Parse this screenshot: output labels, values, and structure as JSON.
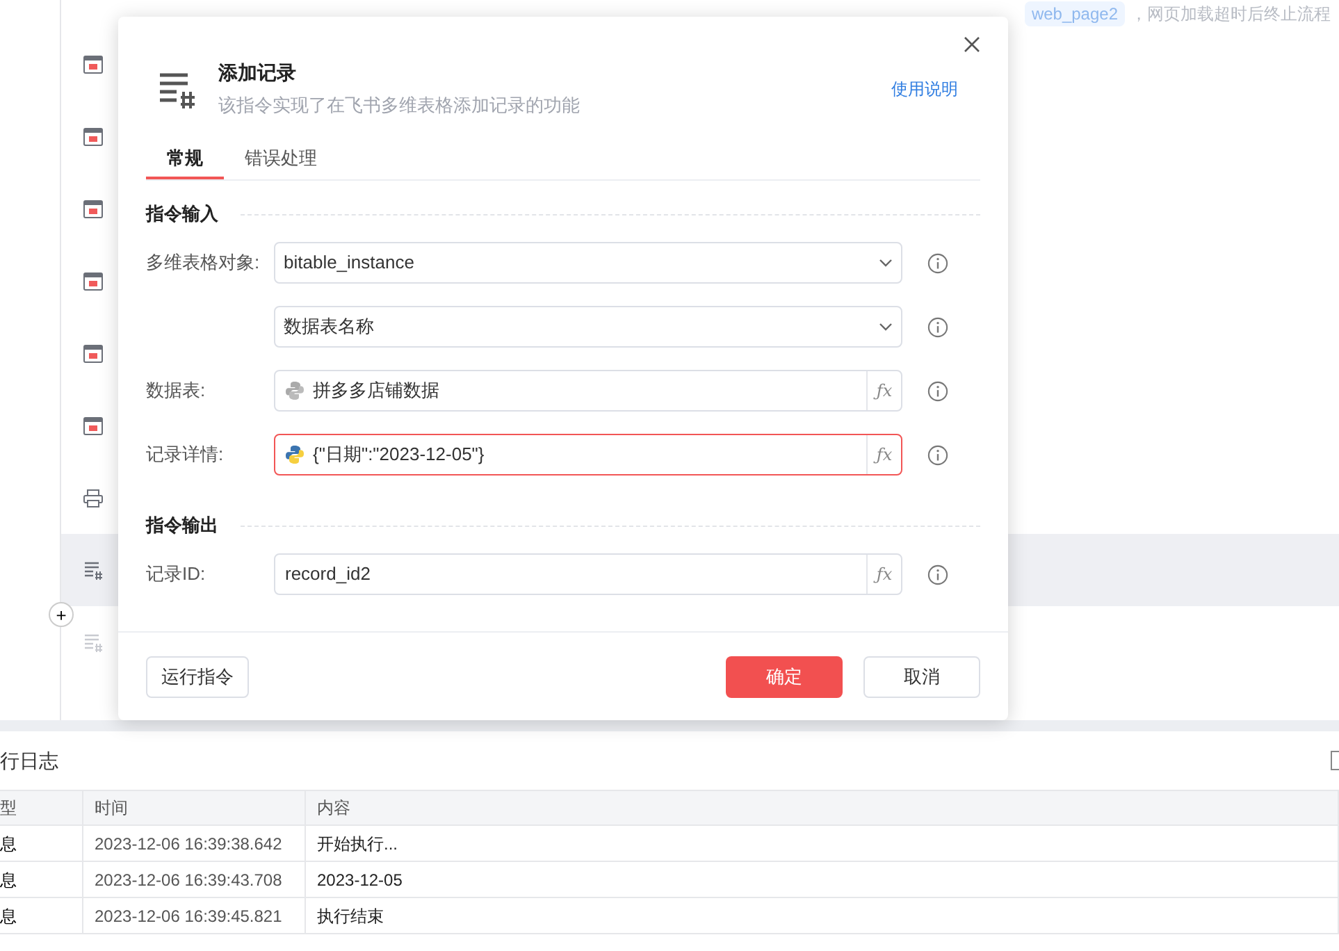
{
  "background_step": {
    "variable": "web_page2",
    "text_after": "，网页加载超时后终止流程"
  },
  "steps": [
    {
      "kind": "window",
      "selected": false,
      "disabled": false
    },
    {
      "kind": "window",
      "selected": false,
      "disabled": false
    },
    {
      "kind": "window",
      "selected": false,
      "disabled": false
    },
    {
      "kind": "window",
      "selected": false,
      "disabled": false
    },
    {
      "kind": "window",
      "selected": false,
      "disabled": false
    },
    {
      "kind": "window",
      "selected": false,
      "disabled": false
    },
    {
      "kind": "printer",
      "selected": false,
      "disabled": false
    },
    {
      "kind": "table",
      "selected": true,
      "disabled": false
    },
    {
      "kind": "table",
      "selected": false,
      "disabled": true
    }
  ],
  "add_button": "+",
  "dialog": {
    "title": "添加记录",
    "description": "该指令实现了在飞书多维表格添加记录的功能",
    "help_link": "使用说明",
    "tabs": [
      {
        "label": "常规",
        "selected": true
      },
      {
        "label": "错误处理",
        "selected": false
      }
    ],
    "sections": [
      {
        "title": "指令输入",
        "fields": [
          {
            "label": "多维表格对象:",
            "kind": "select",
            "value": "bitable_instance",
            "error": false
          },
          {
            "kind": "select",
            "value": "数据表名称",
            "error": false
          },
          {
            "label": "数据表:",
            "kind": "expression",
            "value": "拼多多店铺数据",
            "fx": "ƒx",
            "error": false,
            "python_active": false
          },
          {
            "label": "记录详情:",
            "kind": "expression",
            "value": "{\"日期\":\"2023-12-05\"}",
            "fx": "ƒx",
            "error": true,
            "python_active": true
          }
        ]
      },
      {
        "title": "指令输出",
        "fields": [
          {
            "label": "记录ID:",
            "kind": "variable",
            "value": "record_id2",
            "fx": "ƒx",
            "error": false
          }
        ]
      }
    ],
    "buttons": {
      "run": "运行指令",
      "confirm": "确定",
      "cancel": "取消"
    }
  },
  "log": {
    "title": "行日志",
    "columns": [
      "型",
      "时间",
      "内容"
    ],
    "rows": [
      [
        "息",
        "2023-12-06 16:39:38.642",
        "开始执行..."
      ],
      [
        "息",
        "2023-12-06 16:39:43.708",
        "2023-12-05"
      ],
      [
        "息",
        "2023-12-06 16:39:45.821",
        "执行结束"
      ]
    ]
  }
}
